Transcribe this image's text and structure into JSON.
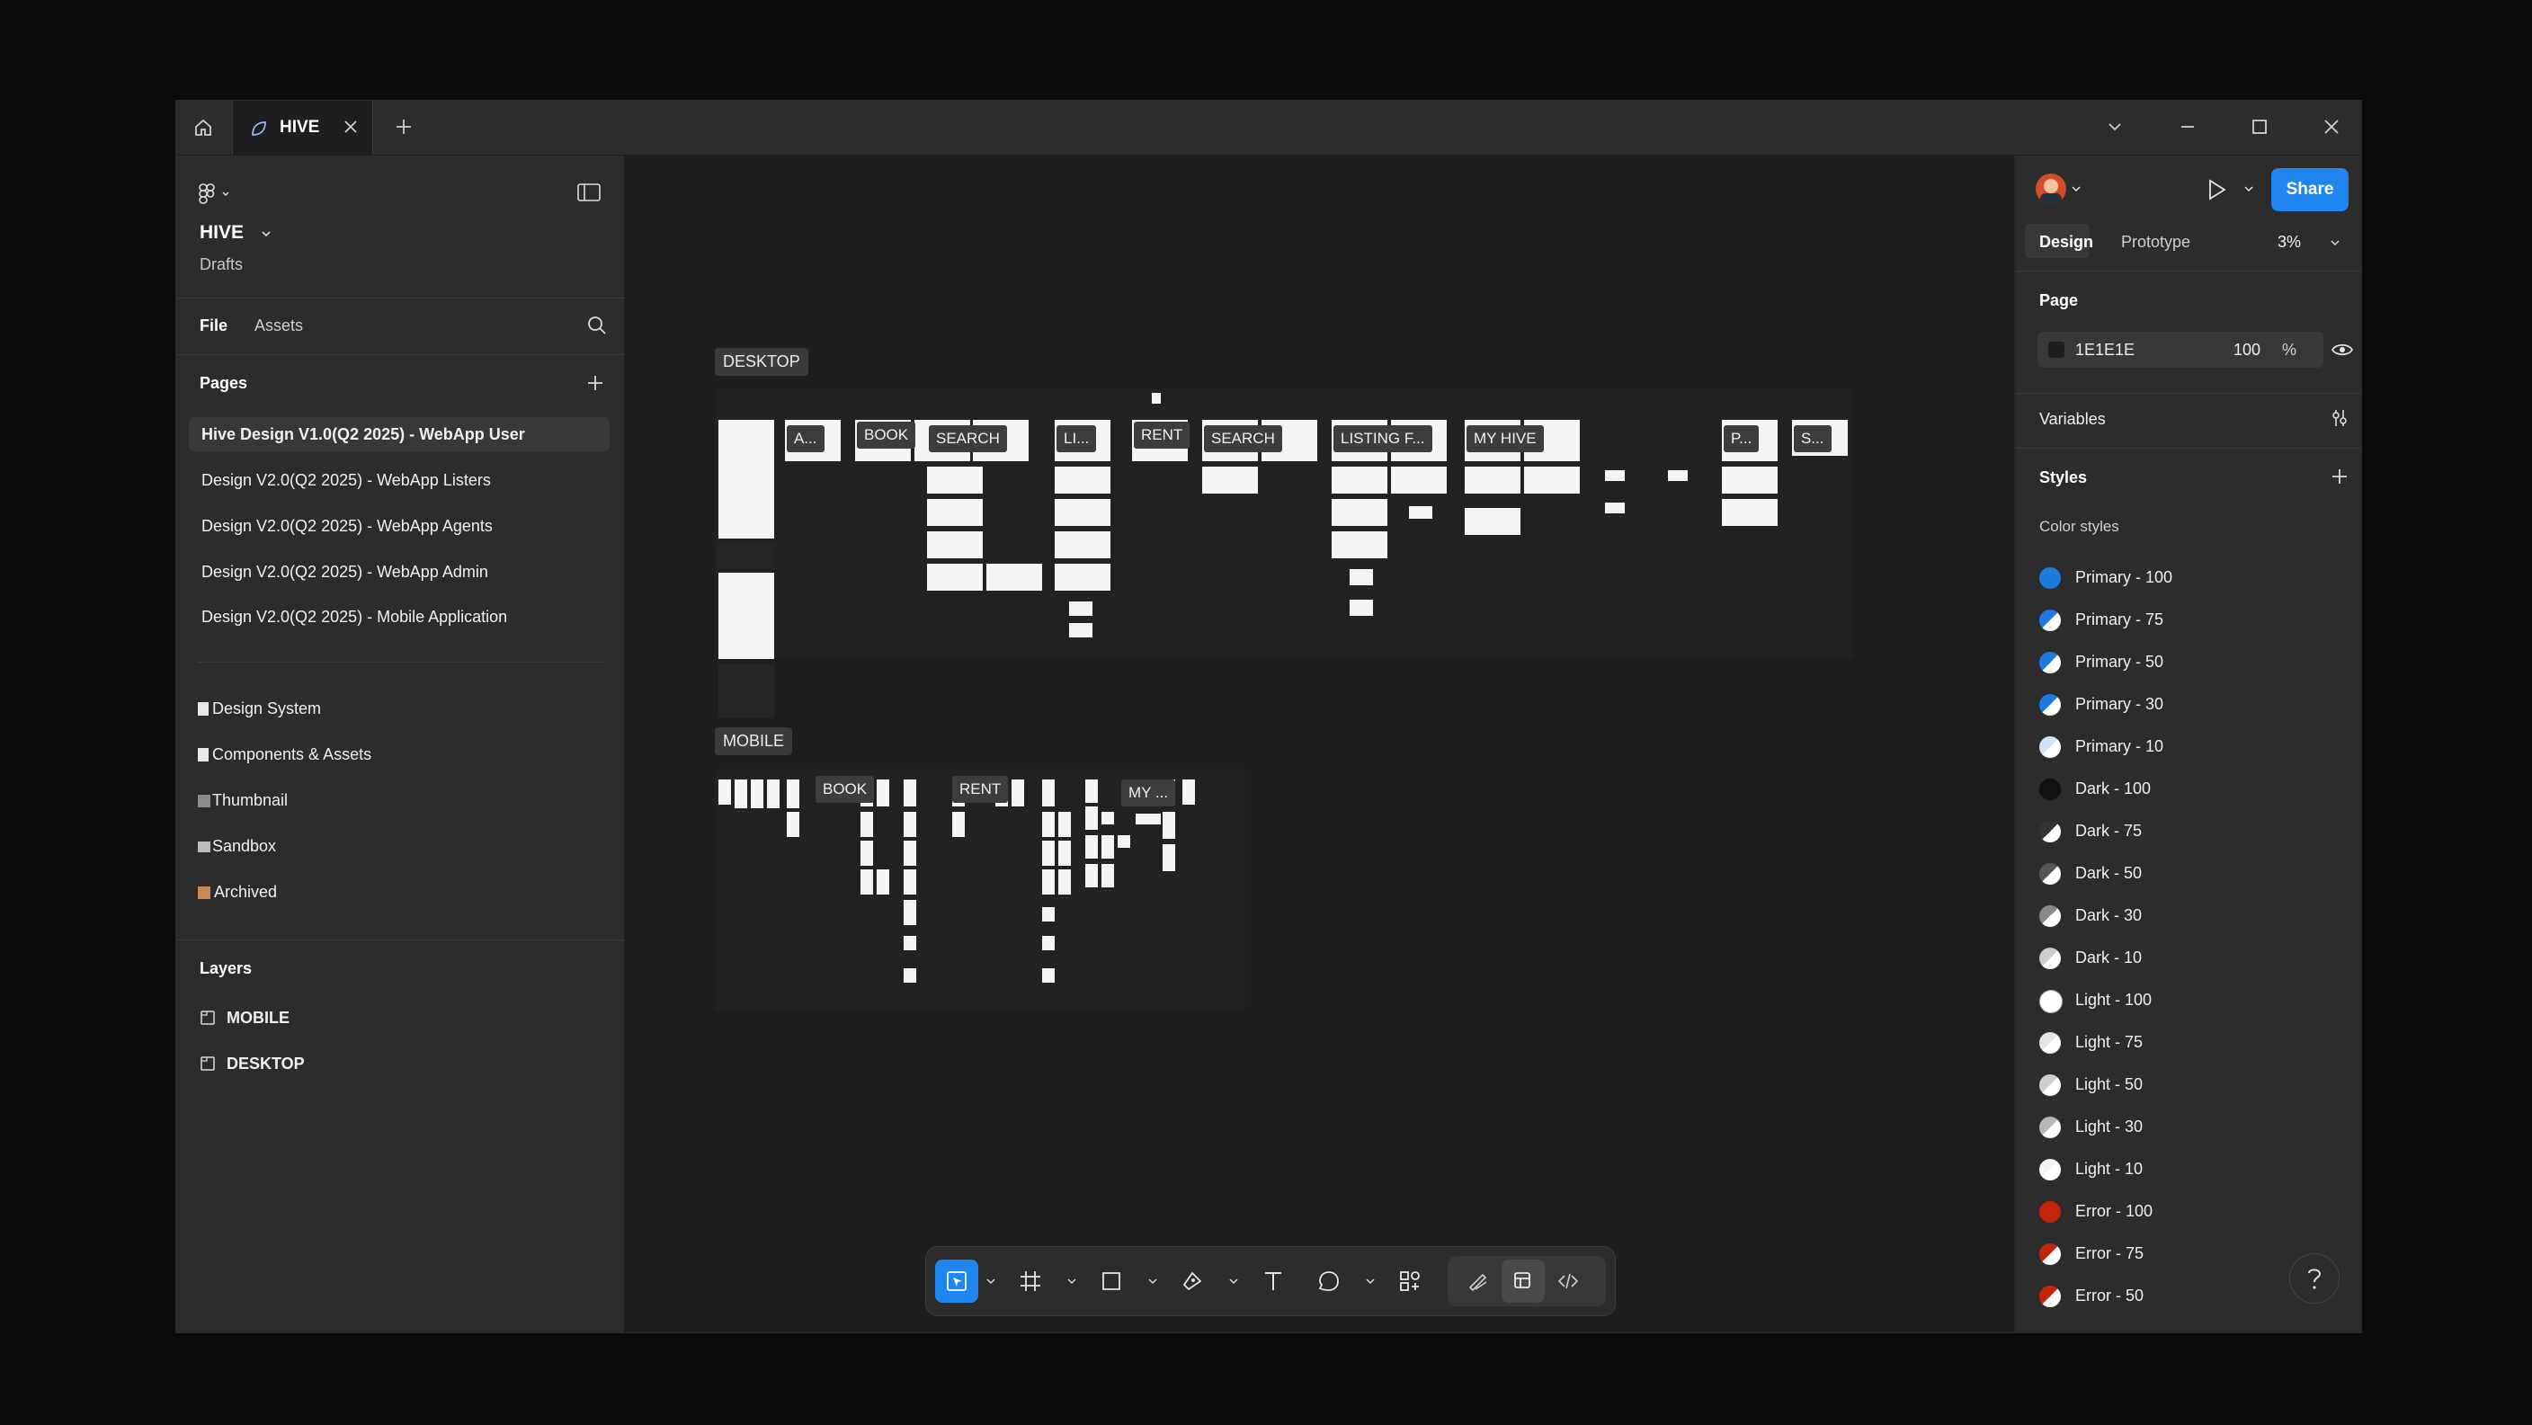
{
  "tabs": {
    "active": "HIVE"
  },
  "file": {
    "name": "HIVE",
    "location": "Drafts"
  },
  "left_tabs": {
    "file": "File",
    "assets": "Assets"
  },
  "pages": {
    "title": "Pages",
    "items": [
      "Hive Design V1.0(Q2 2025) - WebApp User",
      "Design V2.0(Q2 2025) - WebApp Listers",
      "Design V2.0(Q2 2025) - WebApp Agents",
      "Design V2.0(Q2 2025) - WebApp Admin",
      "Design V2.0(Q2 2025) - Mobile Application"
    ],
    "secondary": [
      "Design System",
      "Components & Assets",
      "Thumbnail",
      "Sandbox",
      "Archived"
    ]
  },
  "layers": {
    "title": "Layers",
    "items": [
      "MOBILE",
      "DESKTOP"
    ]
  },
  "canvas": {
    "desktop_label": "DESKTOP",
    "mobile_label": "MOBILE",
    "desktop_sections": [
      "A...",
      "BOOK",
      "SEARCH",
      "LI...",
      "RENT",
      "SEARCH",
      "LISTING F...",
      "MY HIVE",
      "P...",
      "S..."
    ],
    "mobile_sections": [
      "BOOK",
      "RENT",
      "MY ..."
    ]
  },
  "right": {
    "share": "Share",
    "tab_design": "Design",
    "tab_prototype": "Prototype",
    "zoom": "3%",
    "page_title": "Page",
    "page_color": "1E1E1E",
    "page_opacity": "100",
    "page_opacity_unit": "%",
    "variables": "Variables",
    "styles": "Styles",
    "color_styles": "Color styles",
    "style_items": [
      {
        "name": "Primary - 100",
        "color": "#1f7ae0"
      },
      {
        "name": "Primary - 75",
        "color": "#1f7ae0"
      },
      {
        "name": "Primary - 50",
        "color": "#1f7ae0"
      },
      {
        "name": "Primary - 30",
        "color": "#1f7ae0"
      },
      {
        "name": "Primary - 10",
        "color": "#cfe2f8"
      },
      {
        "name": "Dark - 100",
        "color": "#111111"
      },
      {
        "name": "Dark - 75",
        "color": "#333333"
      },
      {
        "name": "Dark - 50",
        "color": "#555555"
      },
      {
        "name": "Dark - 30",
        "color": "#888888"
      },
      {
        "name": "Dark - 10",
        "color": "#cccccc"
      },
      {
        "name": "Light - 100",
        "color": "#ffffff"
      },
      {
        "name": "Light - 75",
        "color": "#e6e6e6"
      },
      {
        "name": "Light - 50",
        "color": "#cfcfcf"
      },
      {
        "name": "Light - 30",
        "color": "#b7b7b7"
      },
      {
        "name": "Light - 10",
        "color": "#f3f3f3"
      },
      {
        "name": "Error - 100",
        "color": "#c2260c"
      },
      {
        "name": "Error - 75",
        "color": "#c2260c"
      },
      {
        "name": "Error - 50",
        "color": "#c2260c"
      }
    ]
  },
  "colors": {
    "accent": "#1f86f0",
    "panel": "#2c2c2c",
    "canvas": "#1e1e1e"
  }
}
